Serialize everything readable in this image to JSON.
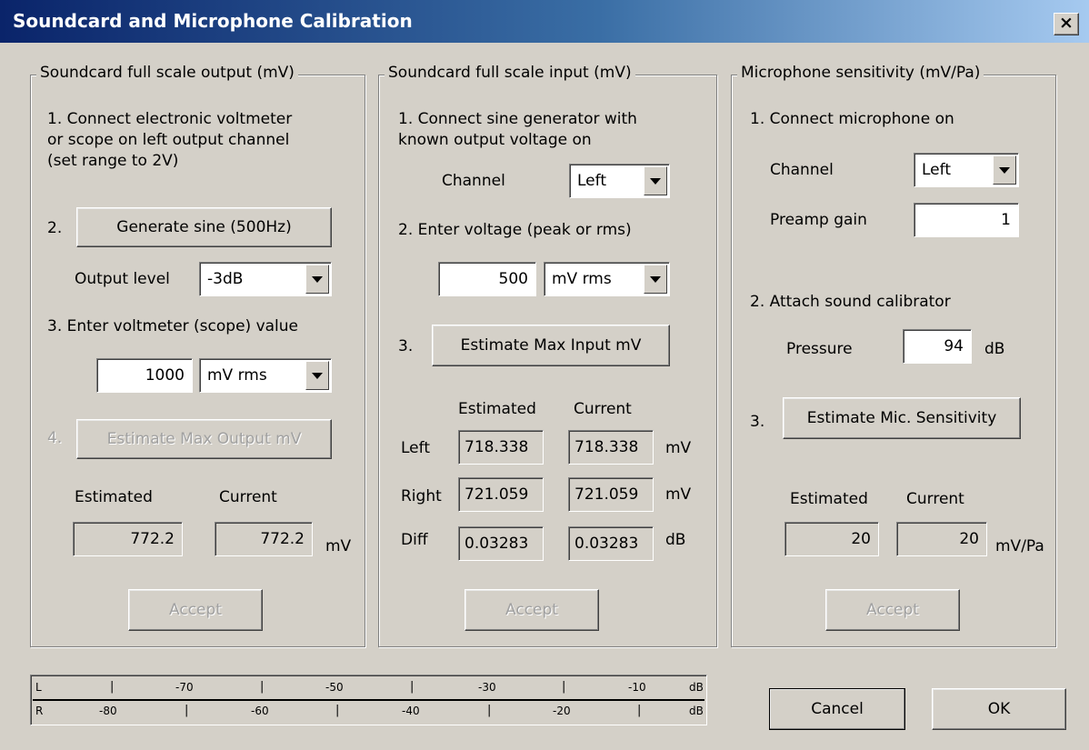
{
  "window": {
    "title": "Soundcard and Microphone Calibration",
    "close_label": "×"
  },
  "output": {
    "legend": "Soundcard full scale output (mV)",
    "step1": [
      "1. Connect electronic voltmeter",
      "or scope on left output channel",
      "(set range  to 2V)"
    ],
    "step2_num": "2.",
    "generate_label": "Generate sine (500Hz)",
    "level_label": "Output level",
    "level_value": "-3dB",
    "step3": "3. Enter voltmeter (scope) value",
    "volt_value": "1000",
    "volt_unit": "mV rms",
    "step4_num": "4.",
    "estimate_label": "Estimate Max Output mV",
    "estimated_header": "Estimated",
    "current_header": "Current",
    "estimated_value": "772.2",
    "current_value": "772.2",
    "unit": "mV",
    "accept_label": "Accept"
  },
  "input": {
    "legend": "Soundcard full scale  input (mV)",
    "step1": [
      "1. Connect sine generator with",
      "known output voltage on"
    ],
    "channel_label": "Channel",
    "channel_value": "Left",
    "step2": "2. Enter voltage (peak or rms)",
    "voltage_value": "500",
    "voltage_unit": "mV rms",
    "step3_num": "3.",
    "estimate_label": "Estimate Max Input mV",
    "estimated_header": "Estimated",
    "current_header": "Current",
    "rows": [
      {
        "label": "Left",
        "estimated": "718.338",
        "current": "718.338",
        "unit": "mV"
      },
      {
        "label": "Right",
        "estimated": "721.059",
        "current": "721.059",
        "unit": "mV"
      },
      {
        "label": "Diff",
        "estimated": "0.03283",
        "current": "0.03283",
        "unit": "dB"
      }
    ],
    "accept_label": "Accept"
  },
  "mic": {
    "legend": "Microphone sensitivity (mV/Pa)",
    "step1": "1. Connect microphone on",
    "channel_label": "Channel",
    "channel_value": "Left",
    "gain_label": "Preamp  gain",
    "gain_value": "1",
    "step2": "2. Attach sound calibrator",
    "pressure_label": "Pressure",
    "pressure_value": "94",
    "pressure_unit": "dB",
    "step3_num": "3.",
    "estimate_label": "Estimate Mic. Sensitivity",
    "estimated_header": "Estimated",
    "current_header": "Current",
    "estimated_value": "20",
    "current_value": "20",
    "unit": "mV/Pa",
    "accept_label": "Accept"
  },
  "meter": {
    "left": {
      "channel": "L",
      "labels": [
        "-70",
        "-50",
        "-30",
        "-10"
      ],
      "unit": "dB"
    },
    "right": {
      "channel": "R",
      "labels": [
        "-80",
        "-60",
        "-40",
        "-20"
      ],
      "unit": "dB"
    }
  },
  "buttons": {
    "cancel": "Cancel",
    "ok": "OK"
  }
}
